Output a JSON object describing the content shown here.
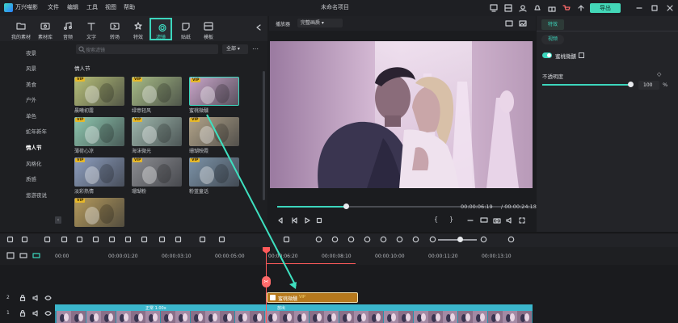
{
  "app": {
    "name": "万兴喵影",
    "project_title": "未命名项目",
    "export_label": "导出"
  },
  "menu": [
    "文件",
    "编辑",
    "工具",
    "视图",
    "帮助"
  ],
  "toolbar": [
    {
      "label": "我的素材",
      "icon": "folder-icon"
    },
    {
      "label": "素材库",
      "icon": "library-icon"
    },
    {
      "label": "音频",
      "icon": "music-icon"
    },
    {
      "label": "文字",
      "icon": "text-icon"
    },
    {
      "label": "转场",
      "icon": "transition-icon"
    },
    {
      "label": "特效",
      "icon": "effects-icon"
    },
    {
      "label": "滤镜",
      "icon": "filter-icon"
    },
    {
      "label": "贴纸",
      "icon": "sticker-icon"
    },
    {
      "label": "模板",
      "icon": "template-icon"
    }
  ],
  "categories": [
    "夜景",
    "风景",
    "美食",
    "户外",
    "单色",
    "蛇年新年",
    "情人节",
    "风格化",
    "质感",
    "悠游夜说"
  ],
  "active_category": "情人节",
  "search": {
    "placeholder": "搜索滤镜",
    "filter": "全部"
  },
  "section_title": "情人节",
  "filters": [
    {
      "label": "晨曦初露",
      "vip": "VIP",
      "color": "#b7c07a"
    },
    {
      "label": "绿意轻风",
      "vip": "VIP",
      "color": "#a7bb86"
    },
    {
      "label": "蜜桃微醺",
      "vip": "VIP",
      "color": "#c9a6c9"
    },
    {
      "label": "薄荷心凉",
      "vip": "VIP",
      "color": "#8fc8b0"
    },
    {
      "label": "海沫微光",
      "vip": "VIP",
      "color": "#9fb8ad"
    },
    {
      "label": "珊瑚映霞",
      "vip": "VIP",
      "color": "#b2a489"
    },
    {
      "label": "淡彩热情",
      "vip": "VIP",
      "color": "#8e9fbf"
    },
    {
      "label": "珊瑚粉",
      "vip": "VIP",
      "color": "#8c8d92"
    },
    {
      "label": "粉蓝童话",
      "vip": "VIP",
      "color": "#7c93a8"
    },
    {
      "label": "",
      "vip": "VIP",
      "color": "#b59a5c"
    }
  ],
  "player": {
    "label": "播放器",
    "quality": "完整画质",
    "current_time": "00:00:06:19",
    "duration": "/ 00:00:24:18",
    "progress": 0.27
  },
  "right_panel": {
    "tab": "特效",
    "subtab": "视频",
    "filter_name": "蜜桃微醺",
    "opacity_label": "不透明度",
    "opacity_value": "100",
    "opacity_unit": "%"
  },
  "ruler": [
    "00:00",
    "00:00:01:20",
    "00:00:03:10",
    "00:00:05:00",
    "00:00:06:20",
    "00:00:08:10",
    "00:00:10:00",
    "00:00:11:20",
    "00:00:13:10"
  ],
  "timeline": {
    "filter_clip": "蜜桃微醺",
    "filter_vip": "VIP",
    "speed_label_1": "正常 1.00x",
    "speed_label_2": "放出",
    "track_2": "2",
    "track_1": "1"
  }
}
